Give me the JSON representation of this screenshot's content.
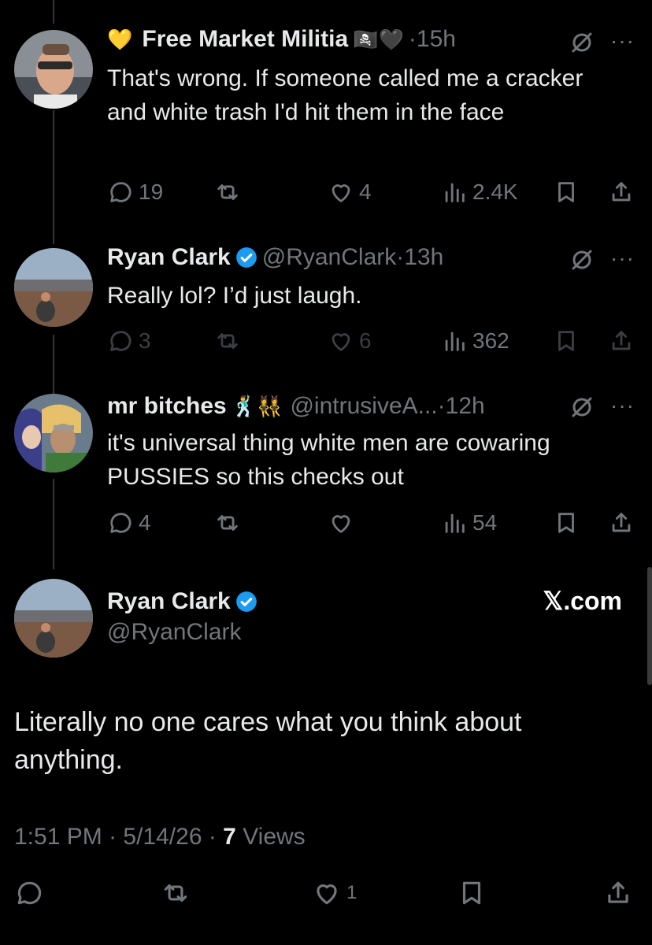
{
  "replies": [
    {
      "name": "Free Market Militia",
      "prefix_emoji": "💛",
      "suffix_emoji": "🏴‍☠️🖤",
      "handle": "",
      "time": "·15h",
      "text": "That's wrong. If someone called me a cracker and white trash I'd hit them in the face",
      "replies": "19",
      "reposts": "",
      "likes": "4",
      "views": "2.4K"
    },
    {
      "name": "Ryan Clark",
      "verified": true,
      "handle": "@RyanClark",
      "time": "·13h",
      "text": "Really lol? I’d just laugh.",
      "replies": "3",
      "reposts": "",
      "likes": "6",
      "views": "362"
    },
    {
      "name": "mr bitches",
      "suffix_emoji": "🕺👯‍♀️",
      "handle": "@intrusiveA...",
      "time": "·12h",
      "text": "it's universal thing white men are cowaring PUSSIES so this checks out",
      "replies": "4",
      "reposts": "",
      "likes": "",
      "views": "54"
    }
  ],
  "main": {
    "name": "Ryan Clark",
    "verified": true,
    "handle": "@RyanClark",
    "text": "Literally no one cares what you think about anything.",
    "time": "1:51 PM",
    "date": "5/14/26",
    "views_count": "7",
    "views_label": "Views",
    "likes": "1",
    "watermark": "𝕏.com"
  },
  "more_label": "···",
  "colors": {
    "background": "#000000",
    "text": "#e7e9ea",
    "muted": "#71767b",
    "verified": "#1d9bf0"
  }
}
